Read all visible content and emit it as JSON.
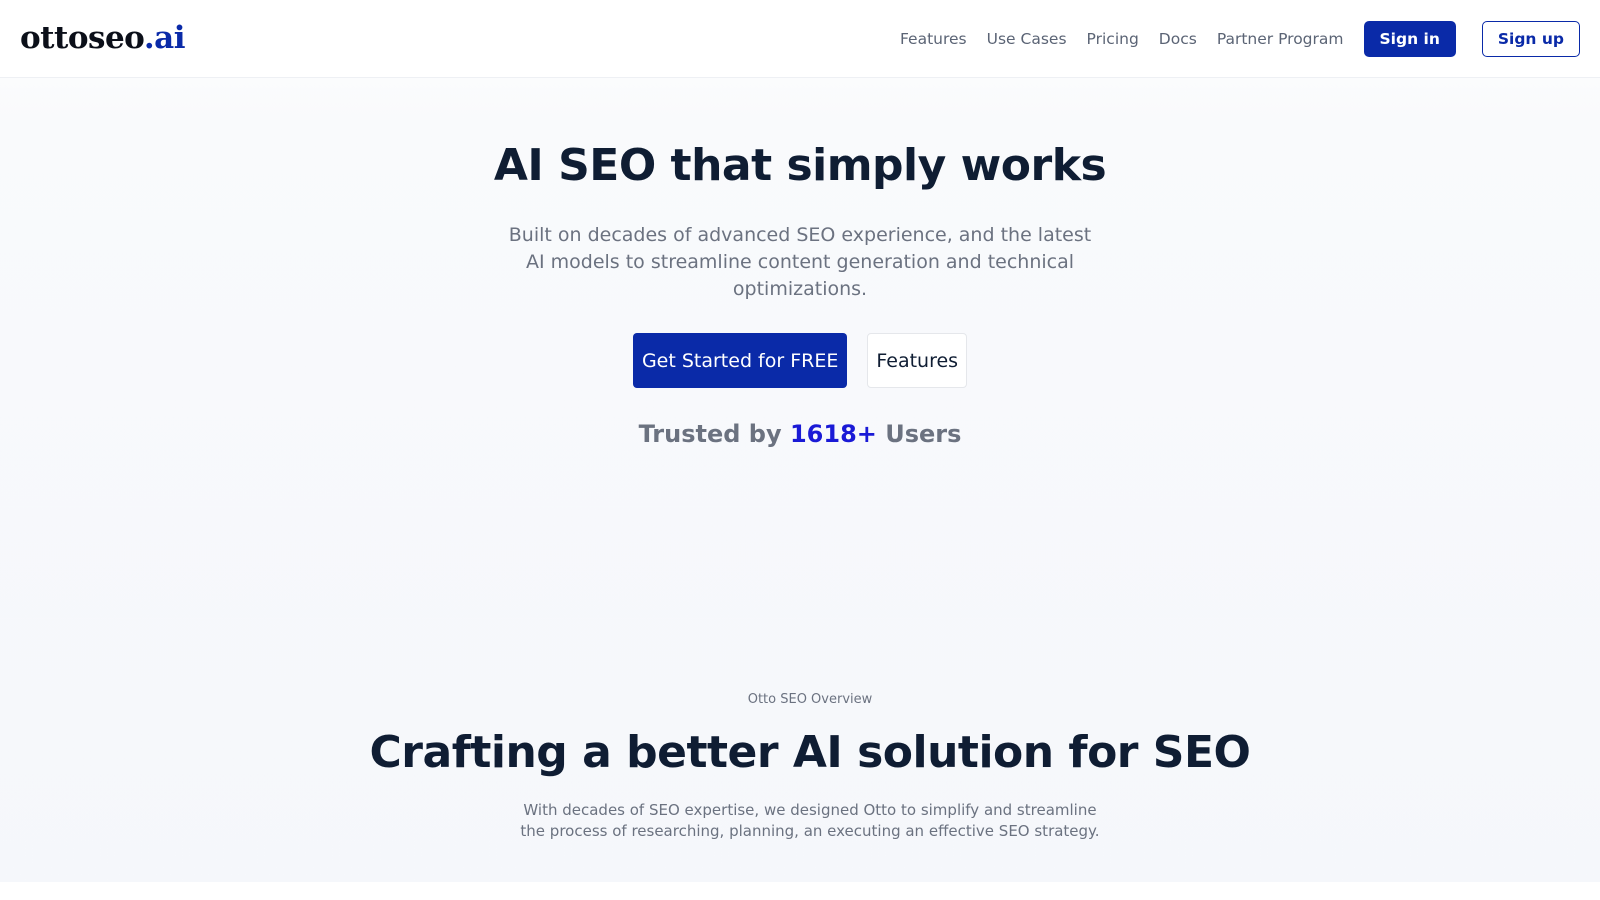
{
  "header": {
    "logo": {
      "main": "ottoseo",
      "accent": ".ai"
    },
    "nav": [
      {
        "label": "Features"
      },
      {
        "label": "Use Cases"
      },
      {
        "label": "Pricing"
      },
      {
        "label": "Docs"
      },
      {
        "label": "Partner Program"
      }
    ],
    "sign_in_label": "Sign in",
    "sign_up_label": "Sign up"
  },
  "hero": {
    "title": "AI SEO that simply works",
    "subtitle": "Built on decades of advanced SEO experience, and the latest AI models to streamline content generation and technical optimizations.",
    "primary_cta": "Get Started for FREE",
    "secondary_cta": "Features",
    "trusted_prefix": "Trusted by",
    "trusted_count": "1618+",
    "trusted_suffix": "Users"
  },
  "overview": {
    "eyebrow": "Otto SEO Overview",
    "title": "Crafting a better AI solution for SEO",
    "description": "With decades of SEO expertise, we designed Otto to simplify and streamline the process of researching, planning, an executing an effective SEO strategy."
  },
  "colors": {
    "brand": "#0a2aa8",
    "heading": "#0f1d33",
    "muted": "#6b7280",
    "count_accent": "#1a1ad6"
  }
}
